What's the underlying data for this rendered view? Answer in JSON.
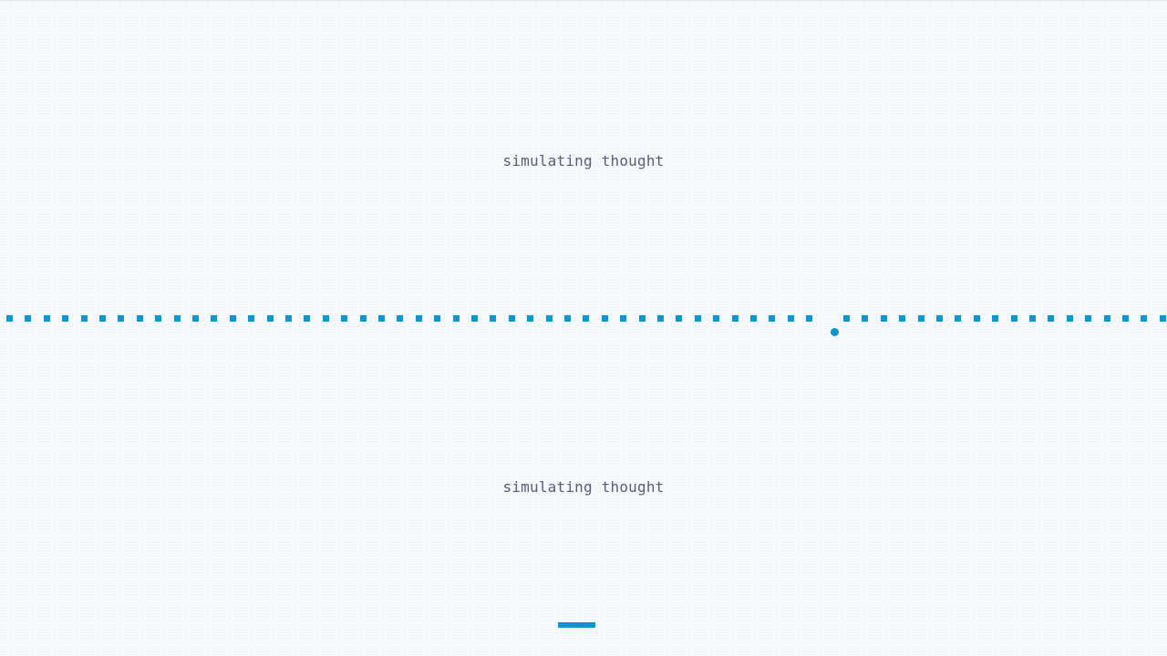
{
  "loading": {
    "caption_top": "simulating thought",
    "caption_bottom": "simulating thought"
  },
  "colors": {
    "accent": "#0b96cf",
    "caption": "#5e5a78",
    "background": "#f6fafc"
  },
  "animation": {
    "dot_count": 63,
    "gap_after_index": 44,
    "dropped_dot": "falling"
  },
  "icons": {
    "loader_bar": "progress-bar-icon",
    "dropped_dot": "falling-dot-icon"
  }
}
